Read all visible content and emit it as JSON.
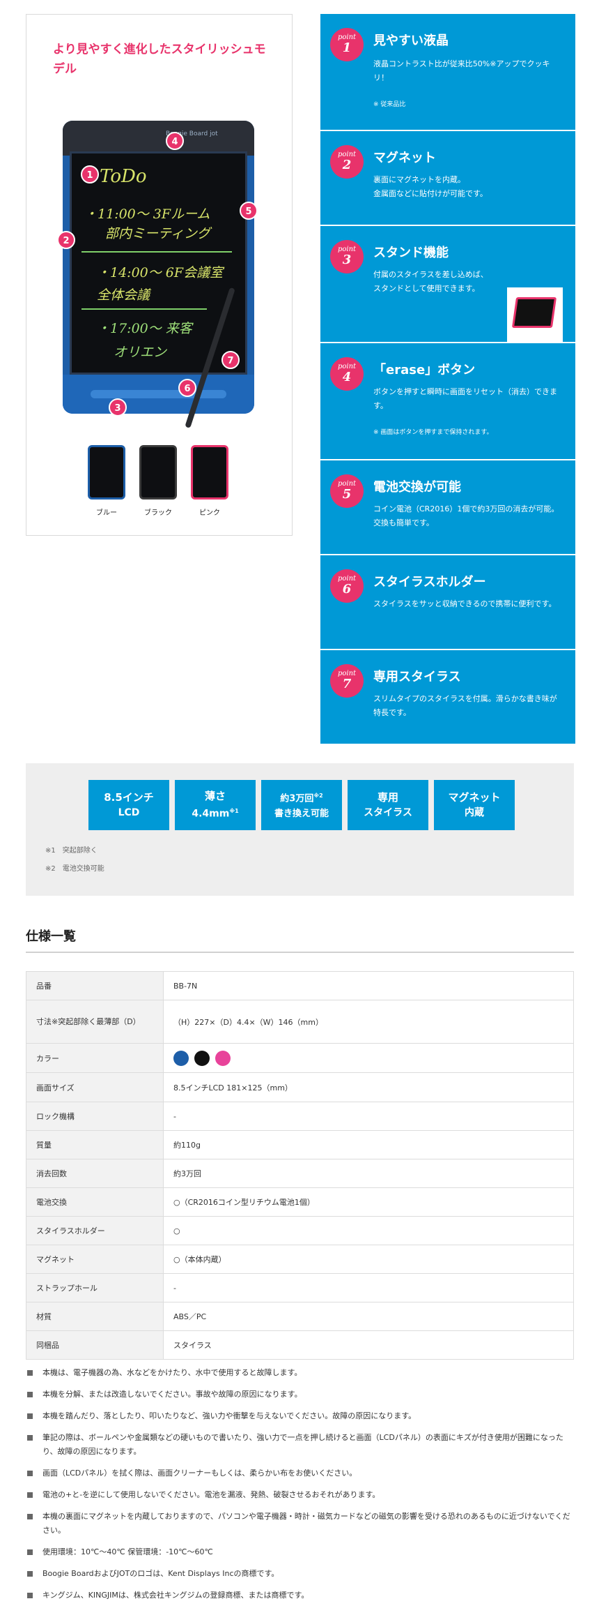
{
  "headline": "より見やすく進化したスタイリッシュモデル",
  "board": {
    "brand": "Boogie Board jot",
    "lines": [
      "ToDo",
      "・11:00〜 3Fルーム",
      "部内ミーティング",
      "・14:00〜 6F会議室",
      "全体会議",
      "・17:00〜 来客",
      "オリエン"
    ],
    "markers": [
      "1",
      "2",
      "3",
      "4",
      "5",
      "6",
      "7"
    ]
  },
  "variants": [
    {
      "label": "ブルー",
      "color": "#1d5ea8"
    },
    {
      "label": "ブラック",
      "color": "#2a2a2a"
    },
    {
      "label": "ピンク",
      "color": "#e8336b"
    }
  ],
  "points": [
    {
      "word": "point",
      "num": "1",
      "title": "見やすい液晶",
      "desc": "液晶コントラスト比が従来比50%※アップでクッキリ！",
      "note": "※ 従来品比"
    },
    {
      "word": "point",
      "num": "2",
      "title": "マグネット",
      "desc": "裏面にマグネットを内蔵。\n金属面などに貼付けが可能です。",
      "note": ""
    },
    {
      "word": "point",
      "num": "3",
      "title": "スタンド機能",
      "desc": "付属のスタイラスを差し込めば、\nスタンドとして使用できます。",
      "note": ""
    },
    {
      "word": "point",
      "num": "4",
      "title": "「erase」ボタン",
      "desc": "ボタンを押すと瞬時に画面をリセット（消去）できます。",
      "note": "※ 画面はボタンを押すまで保持されます。"
    },
    {
      "word": "point",
      "num": "5",
      "title": "電池交換が可能",
      "desc": "コイン電池（CR2016）1個で約3万回の消去が可能。交換も簡単です。",
      "note": ""
    },
    {
      "word": "point",
      "num": "6",
      "title": "スタイラスホルダー",
      "desc": "スタイラスをサッと収納できるので携帯に便利です。",
      "note": ""
    },
    {
      "word": "point",
      "num": "7",
      "title": "専用スタイラス",
      "desc": "スリムタイプのスタイラスを付属。滑らかな書き味が特長です。",
      "note": ""
    }
  ],
  "features": [
    {
      "l1": "8.5インチ",
      "l2": "LCD",
      "sup": ""
    },
    {
      "l1": "薄さ",
      "l2": "4.4mm",
      "sup": "※1"
    },
    {
      "l1": "約3万回",
      "l1sup": "※2",
      "l2": "書き換え可能",
      "sup": ""
    },
    {
      "l1": "専用",
      "l2": "スタイラス",
      "sup": ""
    },
    {
      "l1": "マグネット",
      "l2": "内蔵",
      "sup": ""
    }
  ],
  "band_notes": [
    "※1　突起部除く",
    "※2　電池交換可能"
  ],
  "spec": {
    "title": "仕様一覧",
    "rows": [
      {
        "k": "品番",
        "v": "BB-7N"
      },
      {
        "k": "寸法※突起部除く最薄部（D）",
        "v": "（H）227×（D）4.4×（W）146（mm）"
      },
      {
        "k": "カラー",
        "v": "",
        "colors": [
          "#1d5ea8",
          "#111111",
          "#e8439a"
        ]
      },
      {
        "k": "画面サイズ",
        "v": "8.5インチLCD 181×125（mm）"
      },
      {
        "k": "ロック機構",
        "v": "-"
      },
      {
        "k": "質量",
        "v": "約110g"
      },
      {
        "k": "消去回数",
        "v": "約3万回"
      },
      {
        "k": "電池交換",
        "v": "○（CR2016コイン型リチウム電池1個）"
      },
      {
        "k": "スタイラスホルダー",
        "v": "○"
      },
      {
        "k": "マグネット",
        "v": "○（本体内蔵）"
      },
      {
        "k": "ストラップホール",
        "v": "-"
      },
      {
        "k": "材質",
        "v": "ABS／PC"
      },
      {
        "k": "同梱品",
        "v": "スタイラス"
      }
    ]
  },
  "notes": [
    "本機は、電子機器の為、水などをかけたり、水中で使用すると故障します。",
    "本機を分解、または改造しないでください。事故や故障の原因になります。",
    "本機を踏んだり、落としたり、叩いたりなど、強い力や衝撃を与えないでください。故障の原因になります。",
    "筆記の際は、ボールペンや金属類などの硬いもので書いたり、強い力で一点を押し続けると画面（LCDパネル）の表面にキズが付き使用が困難になったり、故障の原因になります。",
    "画面（LCDパネル）を拭く際は、画面クリーナーもしくは、柔らかい布をお使いください。",
    "電池の+と-を逆にして使用しないでください。電池を漏液、発熱、破裂させるおそれがあります。",
    "本機の裏面にマグネットを内蔵しておりますので、パソコンや電子機器・時計・磁気カードなどの磁気の影響を受ける恐れのあるものに近づけないでください。",
    "使用環境：10℃〜40℃ 保管環境：-10℃〜60℃",
    "Boogie BoardおよびJOTのロゴは、Kent Displays Incの商標です。",
    "キングジム、KINGJIMは、株式会社キングジムの登録商標、または商標です。"
  ]
}
